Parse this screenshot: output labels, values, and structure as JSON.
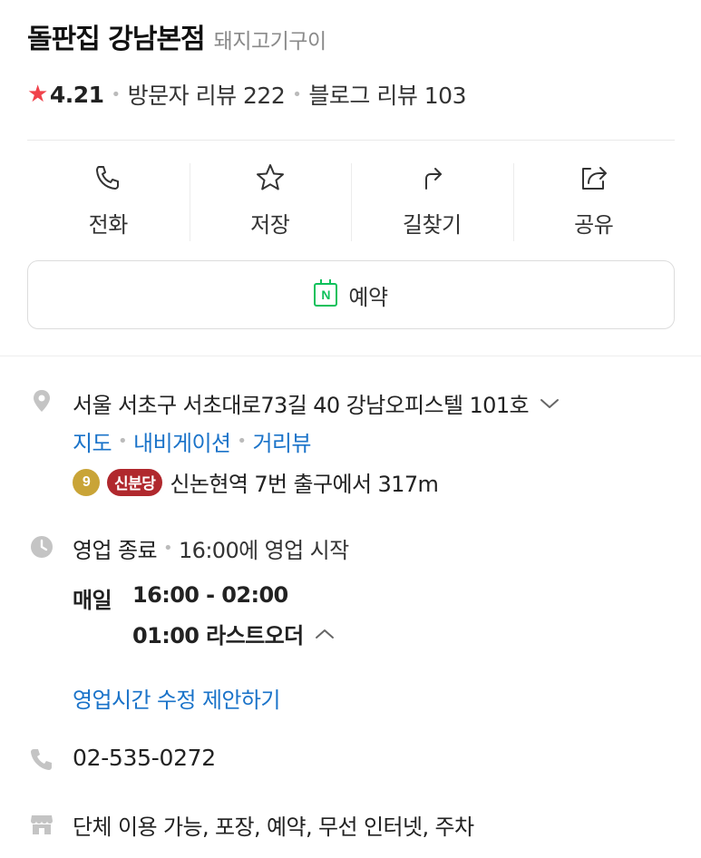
{
  "place": {
    "name": "돌판집 강남본점",
    "category": "돼지고기구이"
  },
  "rating": {
    "score": "4.21",
    "visitor_reviews": "방문자 리뷰 222",
    "blog_reviews": "블로그 리뷰 103"
  },
  "actions": {
    "call_label": "전화",
    "save_label": "저장",
    "directions_label": "길찾기",
    "share_label": "공유",
    "reserve_label": "예약"
  },
  "location": {
    "address": "서울 서초구 서초대로73길 40 강남오피스텔 101호",
    "links": [
      "지도",
      "내비게이션",
      "거리뷰"
    ],
    "subway_line_number": "9",
    "subway_line_name": "신분당",
    "subway_directions": "신논현역 7번 출구에서 317m"
  },
  "hours": {
    "status": "영업 종료",
    "next_open": "16:00에 영업 시작",
    "day": "매일",
    "time_range": "16:00 - 02:00",
    "last_order": "01:00 라스트오더",
    "suggest_edit": "영업시간 수정 제안하기"
  },
  "phone": "02-535-0272",
  "facilities": "단체 이용 가능, 포장, 예약, 무선 인터넷, 주차",
  "colors": {
    "link_blue": "#1a73c9",
    "star_red": "#f0424b",
    "naver_green": "#0ec15b",
    "line9_gold": "#c9a437",
    "sinbundang_red": "#b0282d"
  }
}
